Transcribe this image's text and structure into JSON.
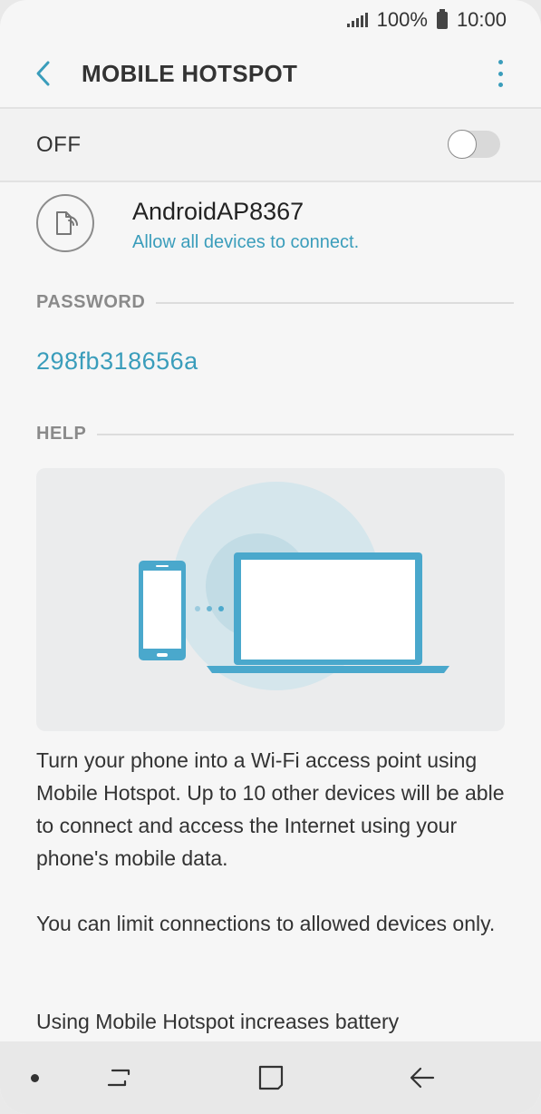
{
  "status_bar": {
    "battery_text": "100%",
    "time": "10:00"
  },
  "header": {
    "title": "MOBILE HOTSPOT"
  },
  "hotspot_switch": {
    "label": "OFF",
    "state": "off"
  },
  "network": {
    "name": "AndroidAP8367",
    "subtitle": "Allow all devices to connect."
  },
  "password_section": {
    "label": "PASSWORD",
    "value": "298fb318656a"
  },
  "help_section": {
    "label": "HELP",
    "paragraphs": [
      "Turn your phone into a Wi-Fi access point using Mobile Hotspot. Up to 10 other devices will be able to connect and access the Internet using your phone's mobile data.",
      "You can limit connections to allowed devices only.",
      "Using Mobile Hotspot increases battery"
    ]
  },
  "colors": {
    "accent": "#3a9dbb",
    "text": "#333333",
    "section_label": "#8a8a8a"
  }
}
